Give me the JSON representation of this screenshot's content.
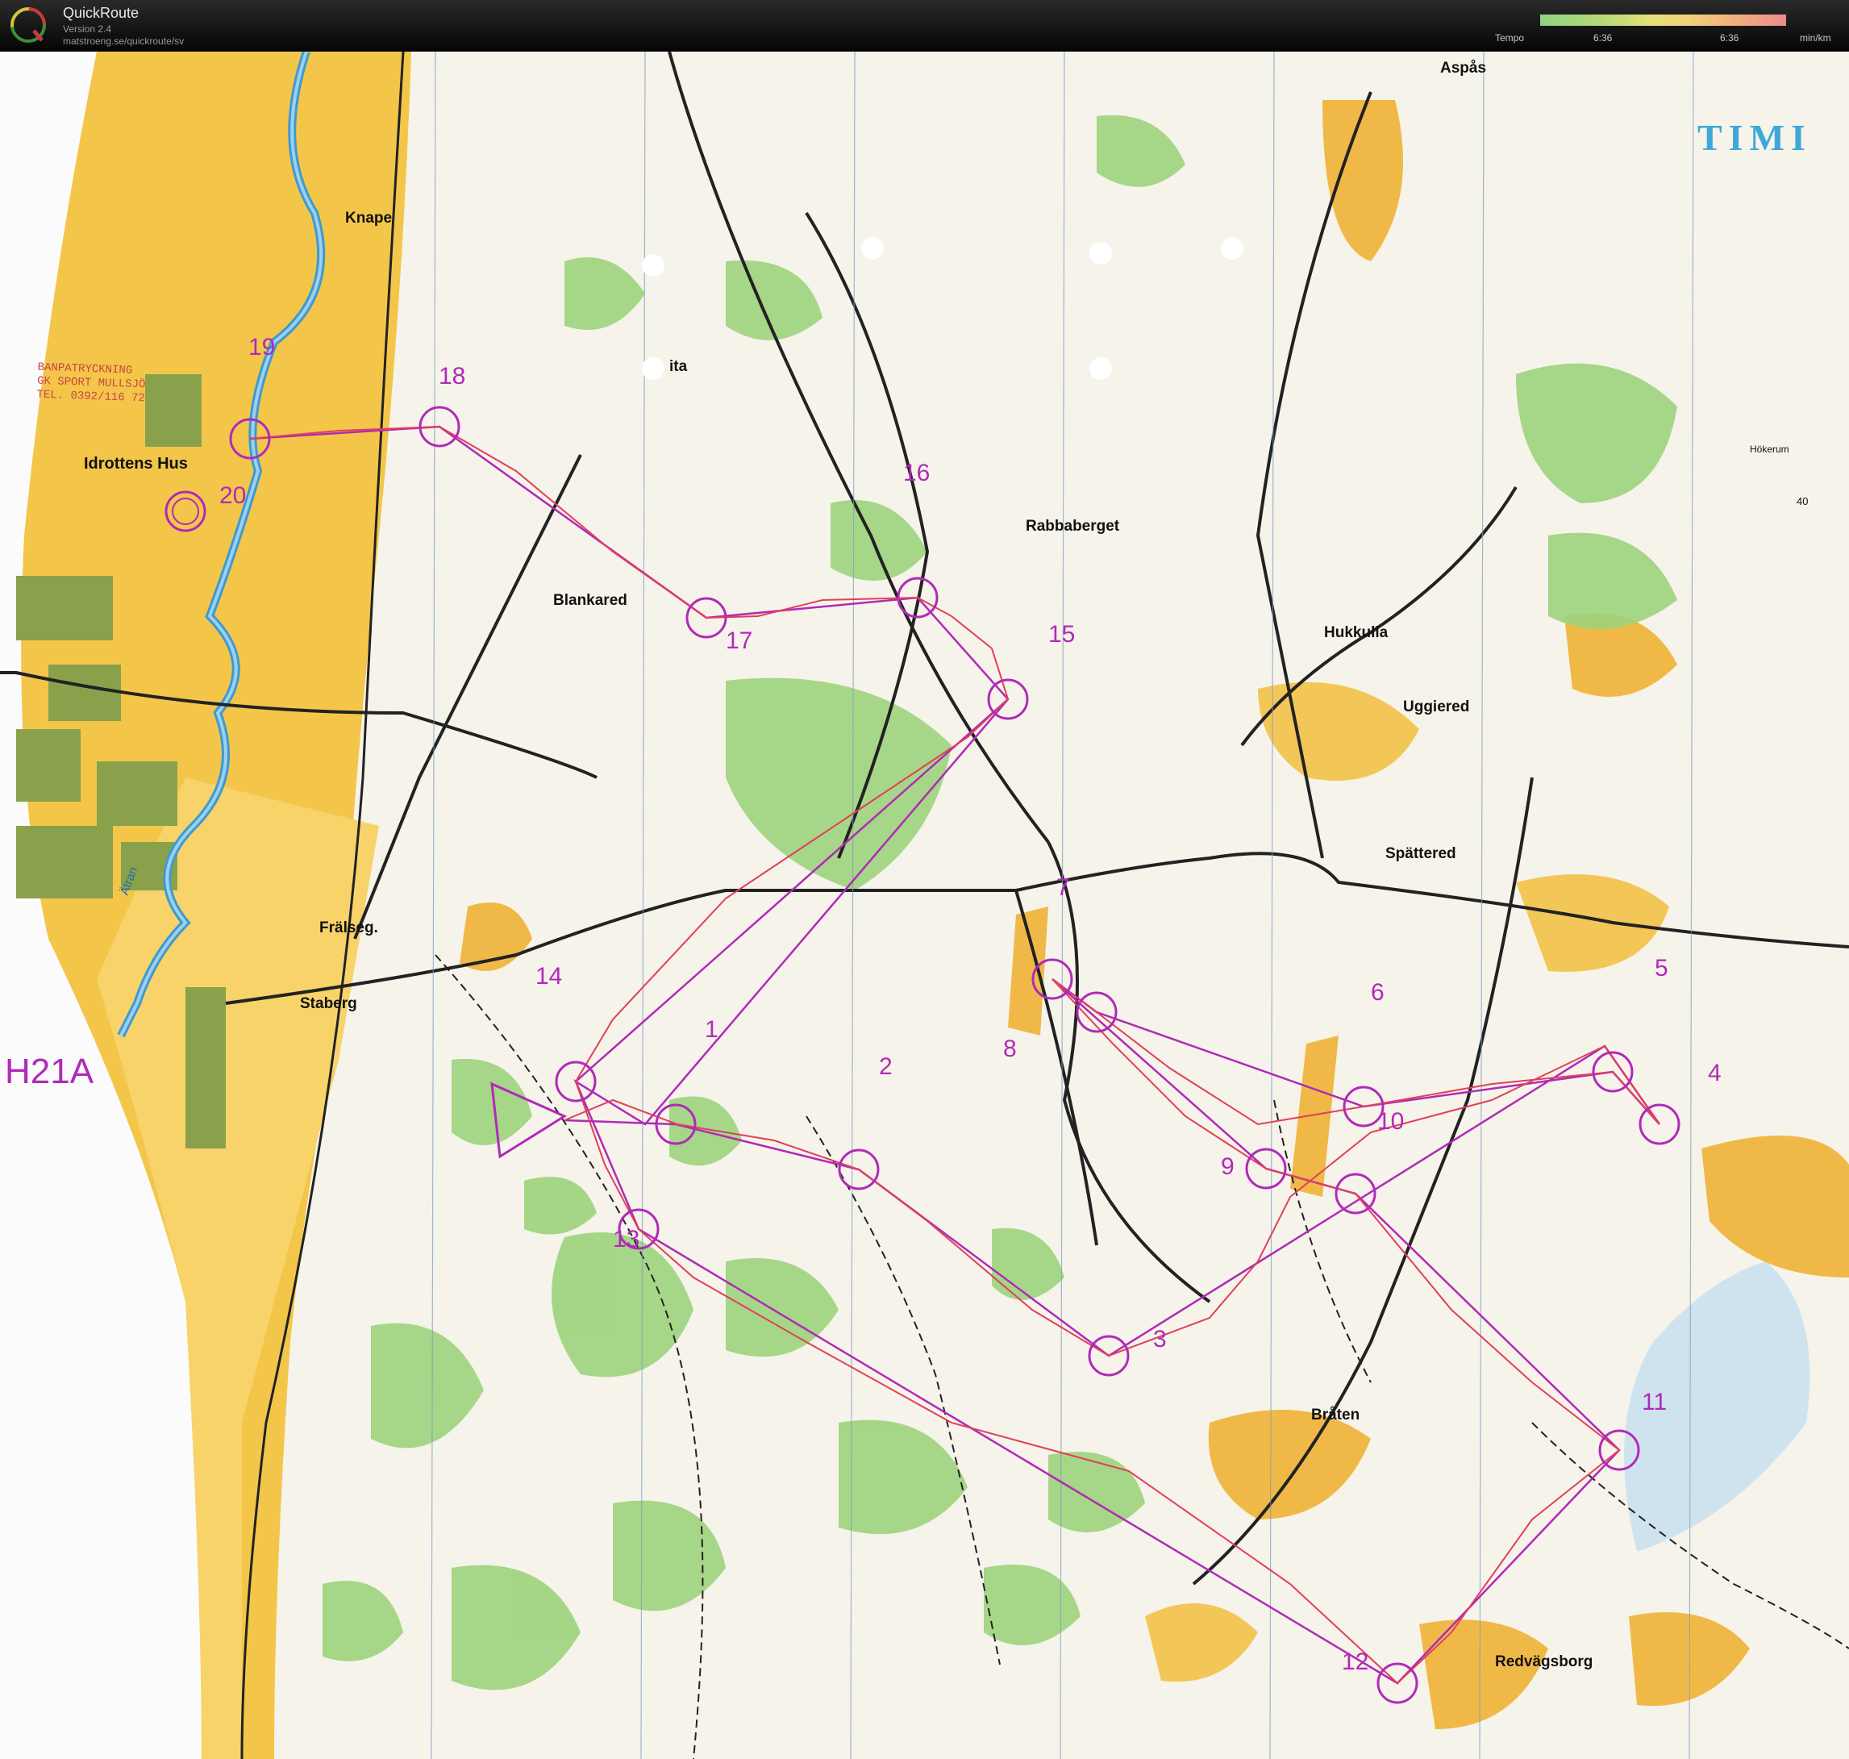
{
  "window": {
    "app_name": "QuickRoute",
    "version": "Version 2.4",
    "url": "matstroeng.se/quickroute/sv"
  },
  "legend": {
    "label": "Tempo",
    "min_value": "6:36",
    "max_value": "6:36",
    "unit": "min/km",
    "colors": [
      "#8ed47f",
      "#e6e07a",
      "#ee8b8b"
    ]
  },
  "map": {
    "course_class": "H21A",
    "title_fragment": "TIMI",
    "printer_note": [
      "BANPATRYCKNING",
      "GK SPORT MULLSJÖ",
      "TEL. 0392/116 72"
    ],
    "places": [
      {
        "id": "aspas",
        "name": "Aspås"
      },
      {
        "id": "knape",
        "name": "Knape"
      },
      {
        "id": "idrottens-hus",
        "name": "Idrottens Hus"
      },
      {
        "id": "blankared",
        "name": "Blankared"
      },
      {
        "id": "rabbaberget",
        "name": "Rabbaberget"
      },
      {
        "id": "hukkulla",
        "name": "Hukkulla"
      },
      {
        "id": "uggiered",
        "name": "Uggiered"
      },
      {
        "id": "spattered",
        "name": "Spättered"
      },
      {
        "id": "fralseg",
        "name": "Frälseg."
      },
      {
        "id": "staberg",
        "name": "Staberg"
      },
      {
        "id": "braten",
        "name": "Bråten"
      },
      {
        "id": "redvagsborg",
        "name": "Redvägsborg"
      },
      {
        "id": "atran",
        "name": "Ätran"
      },
      {
        "id": "hokerum",
        "name": "Hökerum"
      },
      {
        "id": "road-40",
        "name": "40"
      },
      {
        "id": "ita",
        "name": "ita"
      }
    ],
    "controls": [
      "1",
      "2",
      "3",
      "4",
      "5",
      "6",
      "7",
      "8",
      "9",
      "10",
      "11",
      "12",
      "13",
      "14",
      "15",
      "16",
      "17",
      "18",
      "19",
      "20"
    ]
  }
}
